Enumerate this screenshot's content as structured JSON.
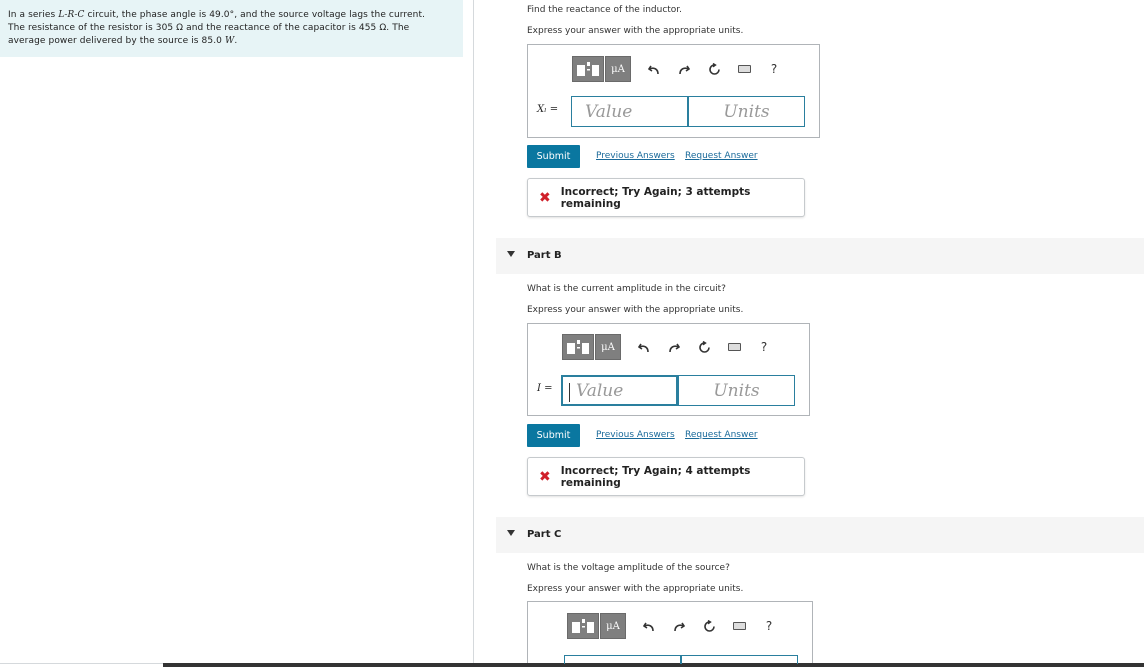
{
  "problem": {
    "line1_a": "In a series ",
    "line1_circuit": "L-R-C",
    "line1_b": " circuit, the phase angle is 49.0°, and the source voltage lags the current.",
    "line2": "The resistance of the resistor is 305 Ω and the reactance of the capacitor is 455 Ω. The",
    "line3_a": "average power delivered by the source is 85.0 ",
    "line3_unit": "W",
    "line3_b": "."
  },
  "partA": {
    "question": "Find the reactance of the inductor.",
    "instruction": "Express your answer with the appropriate units.",
    "var_label": "Xₗ =",
    "value_placeholder": "Value",
    "units_placeholder": "Units",
    "submit_label": "Submit",
    "prev_label": "Previous Answers",
    "request_label": "Request Answer",
    "feedback": "Incorrect; Try Again; 3 attempts remaining"
  },
  "partB": {
    "title": "Part B",
    "question": "What is the current amplitude in the circuit?",
    "instruction": "Express your answer with the appropriate units.",
    "var_label": "I =",
    "value_placeholder": "Value",
    "units_placeholder": "Units",
    "submit_label": "Submit",
    "prev_label": "Previous Answers",
    "request_label": "Request Answer",
    "feedback": "Incorrect; Try Again; 4 attempts remaining"
  },
  "partC": {
    "title": "Part C",
    "question": "What is the voltage amplitude of the source?",
    "instruction": "Express your answer with the appropriate units."
  },
  "toolbar": {
    "mu_label": "μA",
    "help_label": "?"
  },
  "icons": {
    "templates": "templates-icon",
    "units": "units-icon",
    "undo": "undo-icon",
    "redo": "redo-icon",
    "reset": "reset-icon",
    "keyboard": "keyboard-icon",
    "help": "help-icon",
    "caret": "caret-down-icon",
    "incorrect": "x-mark-icon"
  },
  "colors": {
    "accent": "#0a77a0",
    "error": "#d0202a",
    "problem_bg": "#e7f4f6"
  }
}
